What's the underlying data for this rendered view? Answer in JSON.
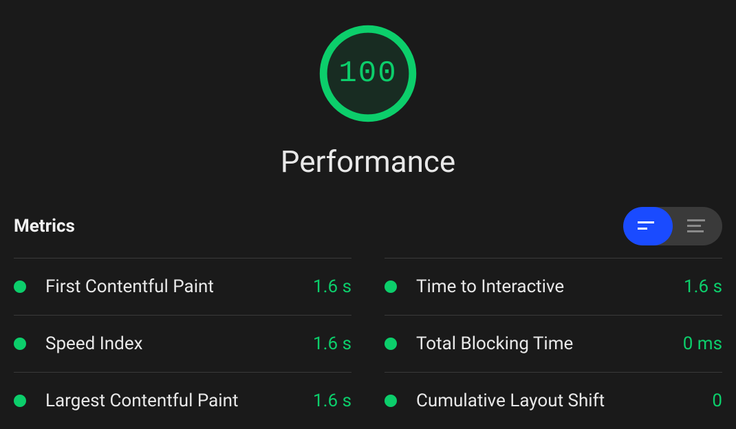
{
  "score": {
    "value": "100",
    "label": "Performance",
    "color": "#0cce6b"
  },
  "metrics_heading": "Metrics",
  "metrics": {
    "left": [
      {
        "label": "First Contentful Paint",
        "value": "1.6 s"
      },
      {
        "label": "Speed Index",
        "value": "1.6 s"
      },
      {
        "label": "Largest Contentful Paint",
        "value": "1.6 s"
      }
    ],
    "right": [
      {
        "label": "Time to Interactive",
        "value": "1.6 s"
      },
      {
        "label": "Total Blocking Time",
        "value": "0 ms"
      },
      {
        "label": "Cumulative Layout Shift",
        "value": "0"
      }
    ]
  }
}
